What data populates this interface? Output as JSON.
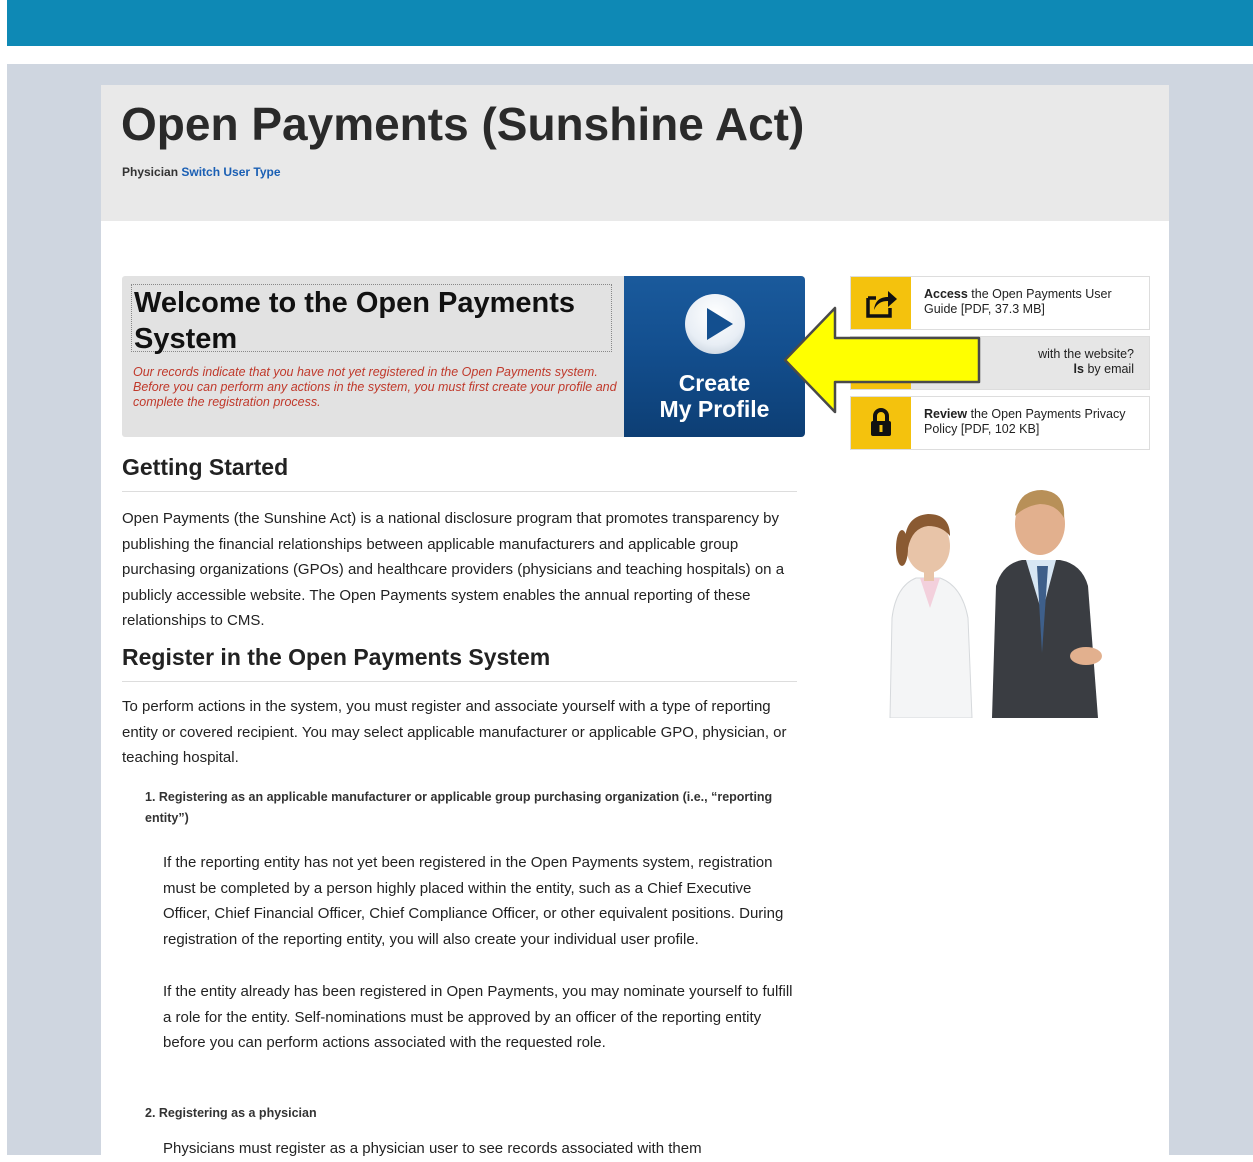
{
  "header": {
    "title": "Open Payments (Sunshine Act)",
    "user_type": "Physician",
    "switch_link": "Switch User Type"
  },
  "welcome": {
    "title": "Welcome to the Open Payments System",
    "message": "Our records indicate that you have not yet registered in the Open Payments system. Before you can perform any actions in the system, you must first create your profile and complete the registration process.",
    "create_line1": "Create",
    "create_line2": "My Profile"
  },
  "sidebar": {
    "items": [
      {
        "bold": "Access",
        "text": " the Open Payments User Guide [PDF, 37.3 MB]",
        "icon": "share-icon"
      },
      {
        "line1": "with the website?",
        "bold": "ls",
        "text": " by email",
        "icon": "help-icon"
      },
      {
        "bold": "Review",
        "text": " the Open Payments Privacy Policy [PDF, 102 KB]",
        "icon": "lock-icon"
      }
    ]
  },
  "colors": {
    "topbar": "#0e89b5",
    "icon_yellow": "#f4c20d",
    "create_blue": "#134f8f",
    "arrow_yellow": "#ffff00",
    "message_red": "#c0392b"
  },
  "main": {
    "getting_started": {
      "heading": "Getting Started",
      "text": "Open Payments (the Sunshine Act) is a national disclosure program that promotes transparency by publishing the financial relationships between applicable manufacturers and applicable group purchasing organizations (GPOs) and healthcare providers (physicians and teaching hospitals) on a publicly accessible website. The Open Payments system enables the annual reporting of these relationships to CMS."
    },
    "register": {
      "heading": "Register in the Open Payments System",
      "text": "To perform actions in the system, you must register and associate yourself with a type of reporting entity or covered recipient. You may select applicable manufacturer or applicable GPO, physician, or teaching hospital.",
      "items": [
        {
          "heading": "1.  Registering as an applicable manufacturer or applicable group purchasing organization (i.e., “reporting entity”)",
          "paragraphs": [
            "If the reporting entity has not yet been registered in the Open Payments system, registration must be completed by a person highly placed within the entity, such as a Chief Executive Officer, Chief Financial Officer, Chief Compliance Officer, or other equivalent positions. During registration of the reporting entity, you will also create your individual user profile.",
            "If the entity already has been registered in Open Payments, you may nominate yourself to fulfill a role for the entity. Self-nominations must be approved by an officer of the reporting entity before you can perform actions associated with the requested role."
          ]
        },
        {
          "heading": "2.  Registering as a physician",
          "paragraphs": [
            "Physicians must register as a physician user to see records associated with them"
          ]
        }
      ]
    }
  }
}
